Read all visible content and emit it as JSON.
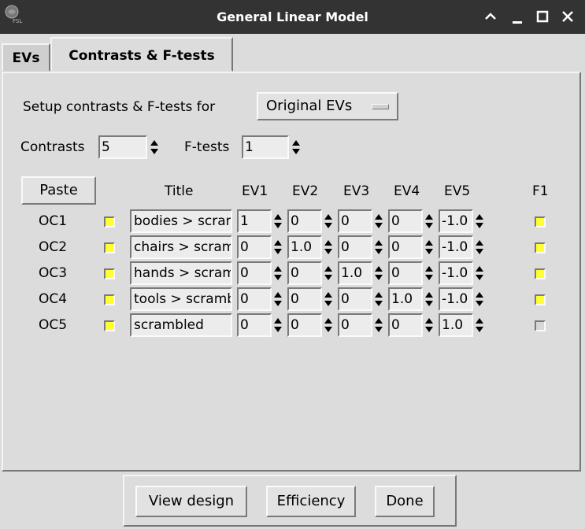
{
  "window": {
    "title": "General Linear Model"
  },
  "tabs": [
    {
      "label": "EVs"
    },
    {
      "label": "Contrasts & F-tests"
    }
  ],
  "setup": {
    "label": "Setup contrasts & F-tests for",
    "dropdown_value": "Original EVs"
  },
  "counts": {
    "contrasts_label": "Contrasts",
    "contrasts_value": "5",
    "ftests_label": "F-tests",
    "ftests_value": "1"
  },
  "table": {
    "paste_label": "Paste",
    "headers": {
      "title": "Title",
      "ev1": "EV1",
      "ev2": "EV2",
      "ev3": "EV3",
      "ev4": "EV4",
      "ev5": "EV5",
      "f1": "F1"
    },
    "rows": [
      {
        "name": "OC1",
        "title": "bodies > scrambled",
        "evs": [
          "1",
          "0",
          "0",
          "0",
          "-1.0"
        ],
        "selected": true,
        "f1": true
      },
      {
        "name": "OC2",
        "title": "chairs > scrambled",
        "evs": [
          "0",
          "1.0",
          "0",
          "0",
          "-1.0"
        ],
        "selected": true,
        "f1": true
      },
      {
        "name": "OC3",
        "title": "hands > scrambled",
        "evs": [
          "0",
          "0",
          "1.0",
          "0",
          "-1.0"
        ],
        "selected": true,
        "f1": true
      },
      {
        "name": "OC4",
        "title": "tools > scrambled",
        "evs": [
          "0",
          "0",
          "0",
          "1.0",
          "-1.0"
        ],
        "selected": true,
        "f1": true
      },
      {
        "name": "OC5",
        "title": "scrambled",
        "evs": [
          "0",
          "0",
          "0",
          "0",
          "1.0"
        ],
        "selected": true,
        "f1": false
      }
    ]
  },
  "buttons": {
    "view_design": "View design",
    "efficiency": "Efficiency",
    "done": "Done"
  },
  "colors": {
    "checked": "#ffff33",
    "unchecked": "#d6d6d6",
    "titlebar": "#333333"
  }
}
